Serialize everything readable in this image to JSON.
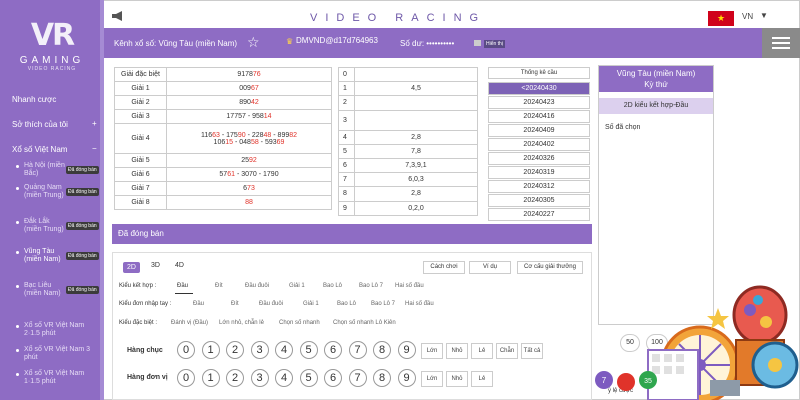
{
  "sidebar": {
    "logo_big": "VR",
    "logo_word": "GAMING",
    "logo_sub": "VIDEO RACING",
    "items": [
      {
        "label": "Nhanh cược"
      },
      {
        "label": "Sở thích của tôi",
        "arrow": "+"
      },
      {
        "label": "Xổ số Việt Nam",
        "arrow": "−"
      }
    ],
    "sub_items": [
      {
        "label": "Hà Nội (miền Bắc)",
        "tag": "Đã đóng bán"
      },
      {
        "label": "Quảng Nam (miền Trung)",
        "tag": "Đã đóng bán"
      },
      {
        "label": "Đắk Lắk (miền Trung)",
        "tag": "Đã đóng bán"
      },
      {
        "label": "Vũng Tàu (miền Nam)",
        "tag": "Đã đóng bán"
      },
      {
        "label": "Bạc Liêu (miền Nam)",
        "tag": "Đã đóng bán"
      },
      {
        "label": "Xổ số VR Việt Nam 2·1.5 phút"
      },
      {
        "label": "Xổ số VR Việt Nam 3 phút"
      },
      {
        "label": "Xổ số VR Việt Nam 1·1.5 phút"
      }
    ]
  },
  "topbar": {
    "brand": "VIDEO RACING",
    "lang": "VN"
  },
  "subbar": {
    "channel_label": "Kênh xổ số: Vũng Tàu (miền Nam)",
    "account": "DMVND@d17d764963",
    "balance_label": "Số dư: ••••••••••",
    "show_btn": "Hiển thị"
  },
  "results": [
    {
      "label": "Giải đặc biệt",
      "pre": "9178",
      "red": "76",
      "post": ""
    },
    {
      "label": "Giải 1",
      "pre": "009",
      "red": "67",
      "post": ""
    },
    {
      "label": "Giải 2",
      "pre": "890",
      "red": "42",
      "post": ""
    },
    {
      "label": "Giải 3",
      "pre": "17757 - 958",
      "red": "14",
      "post": ""
    },
    {
      "label": "Giải 4",
      "multi": true,
      "line1": [
        {
          "t": "116",
          "r": false
        },
        {
          "t": "63",
          "r": true
        },
        {
          "t": " - 175",
          "r": false
        },
        {
          "t": "90",
          "r": true
        },
        {
          "t": " - 228",
          "r": false
        },
        {
          "t": "48",
          "r": true
        },
        {
          "t": " - 899",
          "r": false
        },
        {
          "t": "82",
          "r": true
        }
      ],
      "line2": [
        {
          "t": "106",
          "r": false
        },
        {
          "t": "15",
          "r": true
        },
        {
          "t": " - 048",
          "r": false
        },
        {
          "t": "58",
          "r": true
        },
        {
          "t": " - 593",
          "r": false
        },
        {
          "t": "69",
          "r": true
        }
      ]
    },
    {
      "label": "Giải 5",
      "pre": "25",
      "red": "92",
      "post": ""
    },
    {
      "label": "Giải 6",
      "pre": "57",
      "red": "61",
      "post": " - 3070 - 1790"
    },
    {
      "label": "Giải 7",
      "pre": "6",
      "red": "73",
      "post": ""
    },
    {
      "label": "Giải 8",
      "pre": "",
      "red": "88",
      "post": ""
    }
  ],
  "loto": [
    {
      "head": "0",
      "val": ""
    },
    {
      "head": "1",
      "val": "4,5"
    },
    {
      "head": "2",
      "val": ""
    },
    {
      "head": "3",
      "val": ""
    },
    {
      "head": "4",
      "val": "2,8"
    },
    {
      "head": "5",
      "val": "7,8"
    },
    {
      "head": "6",
      "val": "7,3,9,1"
    },
    {
      "head": "7",
      "val": "6,0,3"
    },
    {
      "head": "8",
      "val": "2,8"
    },
    {
      "head": "9",
      "val": "0,2,0"
    }
  ],
  "stats": {
    "title": "Thống kê cầu",
    "dates": [
      "<20240430",
      "20240423",
      "20240416",
      "20240409",
      "20240402",
      "20240326",
      "20240319",
      "20240312",
      "20240305",
      "20240227"
    ]
  },
  "right_panel": {
    "head_line1": "Vũng Tàu (miền Nam)",
    "head_line2": "Kỳ thứ",
    "mode": "2D kiểu kết hợp-Đầu",
    "selected": "Số đã chọn",
    "chip1": "50",
    "chip2": "100",
    "cta": "ý lệ cược"
  },
  "closed": {
    "label": "Đã đóng bán"
  },
  "bet": {
    "tabs": [
      "2D",
      "3D",
      "4D"
    ],
    "buttons": [
      "Cách chơi",
      "Ví dụ",
      "Cơ cấu giải thưởng"
    ],
    "row1_label": "Kiểu kết hợp :",
    "row1_opts": [
      "Đầu",
      "Đít",
      "Đầu đuôi",
      "Giải 1",
      "Bao Lô",
      "Bao Lô 7",
      "Hai số đầu"
    ],
    "row2_label": "Kiểu đơn nhập tay :",
    "row2_opts": [
      "Đầu",
      "Đít",
      "Đầu đuôi",
      "Giải 1",
      "Bao Lô",
      "Bao Lô 7",
      "Hai số đầu"
    ],
    "row3_label": "Kiểu đặc biệt :",
    "row3_opts": [
      "Đánh vị (Đầu)",
      "Lớn nhỏ, chẵn lẻ",
      "Chọn số nhanh",
      "Chọn số nhanh Lô Kiên"
    ],
    "tens_label": "Hàng chục",
    "units_label": "Hàng đơn vị",
    "digits": [
      "0",
      "1",
      "2",
      "3",
      "4",
      "5",
      "6",
      "7",
      "8",
      "9"
    ],
    "quick_tens": [
      "Lớn",
      "Nhỏ",
      "Lẻ",
      "Chẵn",
      "Tất cả"
    ],
    "quick_units": [
      "Lớn",
      "Nhỏ",
      "Lẻ"
    ]
  },
  "colors": {
    "accent": "#8e6cc4",
    "red": "#e0332a"
  }
}
